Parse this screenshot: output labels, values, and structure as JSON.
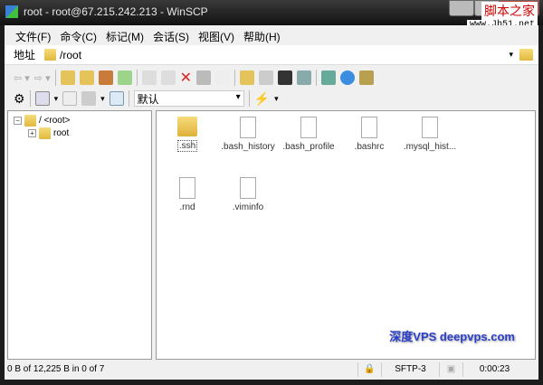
{
  "window": {
    "title": "root - root@67.215.242.213 - WinSCP",
    "watermark_cn": "脚本之家",
    "watermark_url": "www.Jb51.net"
  },
  "menu": [
    "文件(F)",
    "命令(C)",
    "标记(M)",
    "会话(S)",
    "视图(V)",
    "帮助(H)"
  ],
  "address": {
    "label": "地址",
    "path": "/root"
  },
  "toolbar2": {
    "profile": "默认"
  },
  "tree": {
    "root": "/ <root>",
    "child": "root"
  },
  "files": [
    ".ssh",
    ".bash_history",
    ".bash_profile",
    ".bashrc",
    ".mysql_hist...",
    ".rnd",
    ".viminfo"
  ],
  "overlay": "深度VPS deepvps.com",
  "status": {
    "selection": "0 B of 12,225 B in 0 of 7",
    "protocol": "SFTP-3",
    "time": "0:00:23"
  }
}
